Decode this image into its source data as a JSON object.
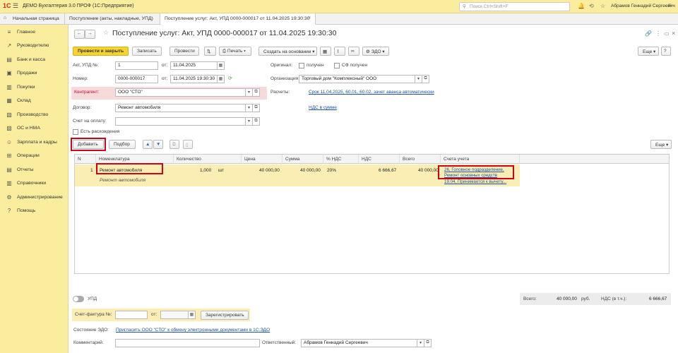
{
  "titlebar": {
    "logo": "1С",
    "app_title": "ДЕМО Бухгалтерия 3.0 ПРОФ  (1С:Предприятие)",
    "search_placeholder": "Поиск Ctrl+Shift+F",
    "user": "Абрамов Геннадий Сергеевич"
  },
  "tabs": [
    {
      "label": "Начальная страница"
    },
    {
      "label": "Поступление (акты, накладные, УПД)"
    },
    {
      "label": "Поступление услуг: Акт, УПД 0000-000017 от 11.04.2025 19:30:30",
      "active": true
    }
  ],
  "sidebar": {
    "items": [
      {
        "label": "Главное",
        "icon": "menu-icon"
      },
      {
        "label": "Руководителю",
        "icon": "chart-icon"
      },
      {
        "label": "Банк и касса",
        "icon": "bank-icon"
      },
      {
        "label": "Продажи",
        "icon": "sales-icon"
      },
      {
        "label": "Покупки",
        "icon": "cart-icon"
      },
      {
        "label": "Склад",
        "icon": "warehouse-icon"
      },
      {
        "label": "Производство",
        "icon": "factory-icon"
      },
      {
        "label": "ОС и НМА",
        "icon": "assets-icon"
      },
      {
        "label": "Зарплата и кадры",
        "icon": "people-icon"
      },
      {
        "label": "Операции",
        "icon": "operations-icon"
      },
      {
        "label": "Отчеты",
        "icon": "reports-icon"
      },
      {
        "label": "Справочники",
        "icon": "book-icon"
      },
      {
        "label": "Администрирование",
        "icon": "settings-icon"
      },
      {
        "label": "Помощь",
        "icon": "help-icon"
      }
    ]
  },
  "doc": {
    "title": "Поступление услуг: Акт, УПД 0000-000017 от 11.04.2025 19:30:30",
    "toolbar": {
      "post_close": "Провести и закрыть",
      "save": "Записать",
      "post": "Провести",
      "print": "Печать",
      "create_based": "Создать на основании",
      "edo": "ЭДО",
      "more": "Еще"
    },
    "fields": {
      "act_label": "Акт, УПД №:",
      "act_value": "1",
      "from_label": "от:",
      "act_date": "11.04.2025",
      "number_label": "Номер:",
      "number_value": "0000-000017",
      "number_date": "11.04.2025 19:30:30",
      "original_label": "Оригинал:",
      "received": "получен",
      "sf_received": "СФ получен",
      "org_label": "Организация:",
      "org_value": "Торговый дом \"Комплексный\" ООО",
      "contractor_label": "Контрагент:",
      "contractor_value": "ООО \"СТО\"",
      "settlements_label": "Расчеты:",
      "settlements_link": "Срок 11.04.2025, 60.01, 60.02, зачет аванса автоматически",
      "contract_label": "Договор:",
      "contract_value": "Ремонт автомобиля",
      "vat_link": "НДС в сумме",
      "invoice_label": "Счет на оплату:",
      "discrepancy_label": "Есть расхождения"
    },
    "table_toolbar": {
      "add": "Добавить",
      "pick": "Подбор",
      "more": "Еще"
    },
    "columns": [
      "N",
      "Номенклатура",
      "Количество",
      "Цена",
      "Сумма",
      "% НДС",
      "НДС",
      "Всего",
      "Счета учета"
    ],
    "rows": [
      {
        "n": "1",
        "item": "Ремонт автомобиля",
        "item_sub": "Ремонт автомобиля",
        "qty": "1,000",
        "unit": "шт",
        "price": "40 000,00",
        "sum": "40 000,00",
        "vat_rate": "20%",
        "vat": "6 666,67",
        "total": "40 000,00",
        "accounts": [
          "26, Головное подразделение,",
          "Ремонт основных средств",
          "19.04, Принимается к вычету..."
        ]
      }
    ],
    "footer": {
      "upd_label": "УПД",
      "invoice_label": "Счет-фактура №:",
      "from_label": "от:",
      "register": "Зарегистрировать",
      "edo_state_label": "Состояние ЭДО:",
      "edo_state_link": "Пригласить ООО \"СТО\" к обмену электронными документами в 1С:ЭДО",
      "comment_label": "Комментарий:",
      "responsible_label": "Ответственный:",
      "responsible_value": "Абрамов Геннадий Сергеевич",
      "total_label": "Всего:",
      "total_value": "40 000,00",
      "currency": "руб.",
      "vat_label": "НДС (в т.ч.):",
      "vat_value": "6 666,67"
    }
  }
}
